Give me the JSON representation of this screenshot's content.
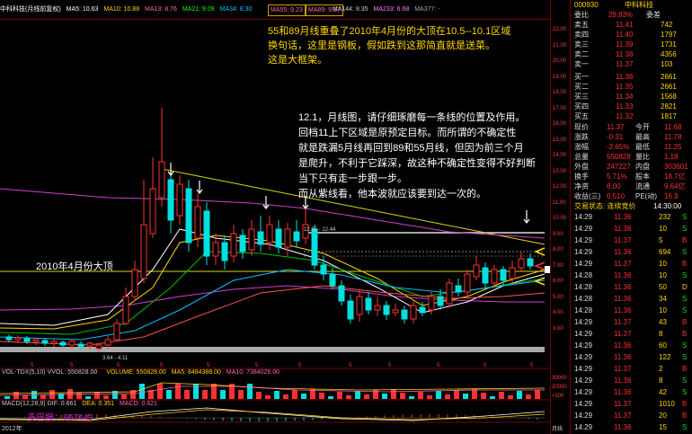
{
  "top": {
    "items": [
      "中科科技(月线前复权)",
      "MA5: 10.63",
      "MA10: 10.88",
      "MA13: 8.76",
      "MA21: 9.09",
      "MA34: 8.30",
      "MA55: 9.23",
      "MA89: 9.67",
      "MA144: 8.35",
      "MA233: 6.68",
      "MA377: -"
    ],
    "ma_box1": "MA55: 9.23",
    "ma_box2": "MA89: 9.67"
  },
  "axis_labels": [
    "22.00",
    "21.00",
    "20.00",
    "19.00",
    "18.00",
    "17.00",
    "16.00",
    "15.00",
    "14.00",
    "13.00",
    "12.00",
    "11.00",
    "10.00",
    "9.00",
    "8.00",
    "7.00",
    "6.00",
    "5.00",
    "4.00",
    "3.00"
  ],
  "notes": {
    "n1": "55和89月线重叠了2010年4月份的大顶在10.5--10.1区域",
    "n2": "换句话，这里是钢板，假如跌到这那简直就是送菜。",
    "n3": "这是大框架。",
    "m1": "12.1，月线图，请仔细琢磨每一条线的位置及作用。",
    "m2": "回档11上下区域是原预定目标。而所谓的不确定性",
    "m3": "就是跌漏5月线再回到89和55月线，但因为前三个月",
    "m4": "是爬升，不利于它踩深，故这种不确定性变得不好判断",
    "m5": "当下只有走一步跟一步。",
    "m6": "而从紫线看，他本波就应该要到达一次的。",
    "big_top": "2010年4月份大顶",
    "price_tag": "12.65 - 12.44",
    "low_tag": "3.64 - 4.11"
  },
  "vol_bar": {
    "label1": "VOL-TDX(5,10) VVOL: 550828.00",
    "label2": "VOLUME: 550828.00",
    "label3": "MA5: 8484388.00",
    "label4": "MA10: 7384026.00",
    "axis1": "30000",
    "axis2": "20000",
    "axis3": "10000",
    "unit": "×100"
  },
  "macd_bar": {
    "label1": "MACD(12,26,9) DIF: 0.661",
    "label2": "DEA: 0.351",
    "label3": "MACD: 0.621",
    "watermark": "多巴胺：807443"
  },
  "bottom": {
    "year": "2012年",
    "period": "月线"
  },
  "quote": {
    "code": "000930",
    "name": "中科科技",
    "weibi_label": "委比",
    "weibi": "29.83%",
    "weicha_label": "委差",
    "sell": [
      {
        "label": "卖五",
        "price": "11.41",
        "vol": "742"
      },
      {
        "label": "卖四",
        "price": "11.40",
        "vol": "1797"
      },
      {
        "label": "卖三",
        "price": "11.39",
        "vol": "1731"
      },
      {
        "label": "卖二",
        "price": "11.38",
        "vol": "4356"
      },
      {
        "label": "卖一",
        "price": "11.37",
        "vol": "103"
      }
    ],
    "buy": [
      {
        "label": "买一",
        "price": "11.36",
        "vol": "2661"
      },
      {
        "label": "买二",
        "price": "11.35",
        "vol": "2661"
      },
      {
        "label": "买三",
        "price": "11.34",
        "vol": "1568"
      },
      {
        "label": "买四",
        "price": "11.33",
        "vol": "2821"
      },
      {
        "label": "买五",
        "price": "11.32",
        "vol": "1817"
      }
    ],
    "stats": [
      {
        "a": "现价",
        "b": "11.37",
        "c": "今开",
        "d": "11.68"
      },
      {
        "a": "涨跌",
        "b": "-0.31",
        "c": "最高",
        "d": "11.78"
      },
      {
        "a": "涨幅",
        "b": "-2.65%",
        "c": "最低",
        "d": "11.25"
      },
      {
        "a": "总量",
        "b": "550828",
        "c": "量比",
        "d": "1.18"
      },
      {
        "a": "外盘",
        "b": "247227",
        "c": "内盘",
        "d": "303601"
      },
      {
        "a": "换手",
        "b": "5.71%",
        "c": "股本",
        "d": "18.7亿"
      },
      {
        "a": "净资",
        "b": "6.00",
        "c": "流通",
        "d": "9.64亿"
      },
      {
        "a": "收益(三)",
        "b": "0.510",
        "c": "PE(动)",
        "d": "16.9"
      }
    ],
    "status_label": "交易状态: 连续竞价",
    "status_time": "14:30:00",
    "ticks": [
      {
        "t": "14:29",
        "p": "11.36",
        "v": "232",
        "f": "S"
      },
      {
        "t": "14:29",
        "p": "11.36",
        "v": "10",
        "f": "S"
      },
      {
        "t": "14:29",
        "p": "11.37",
        "v": "5",
        "f": "B"
      },
      {
        "t": "14:29",
        "p": "11.36",
        "v": "694",
        "f": "S"
      },
      {
        "t": "14:29",
        "p": "11.37",
        "v": "10",
        "f": "B"
      },
      {
        "t": "14:28",
        "p": "11.36",
        "v": "10",
        "f": "S"
      },
      {
        "t": "14:28",
        "p": "11.36",
        "v": "50",
        "f": "D"
      },
      {
        "t": "14:28",
        "p": "11.36",
        "v": "34",
        "f": "S"
      },
      {
        "t": "14:28",
        "p": "11.36",
        "v": "10",
        "f": "S"
      },
      {
        "t": "14:29",
        "p": "11.37",
        "v": "43",
        "f": "B"
      },
      {
        "t": "14:29",
        "p": "11.37",
        "v": "8",
        "f": "B"
      },
      {
        "t": "14:29",
        "p": "11.36",
        "v": "60",
        "f": "S"
      },
      {
        "t": "14:29",
        "p": "11.36",
        "v": "122",
        "f": "S"
      },
      {
        "t": "14:29",
        "p": "11.37",
        "v": "2",
        "f": "B"
      },
      {
        "t": "14:29",
        "p": "11.36",
        "v": "8",
        "f": "S"
      },
      {
        "t": "14:29",
        "p": "11.36",
        "v": "42",
        "f": "S"
      },
      {
        "t": "14:29",
        "p": "11.37",
        "v": "1010",
        "f": "B"
      },
      {
        "t": "14:29",
        "p": "11.37",
        "v": "20",
        "f": "B"
      },
      {
        "t": "14:29",
        "p": "11.36",
        "v": "15",
        "f": "S"
      }
    ]
  },
  "colors": {
    "up": "#ff3030",
    "down": "#00e0e0",
    "ma5": "#ffffff",
    "ma10": "#ffd700",
    "ma_purple": "#d040d0",
    "ma_green": "#00c000",
    "box": "#c8a000"
  }
}
